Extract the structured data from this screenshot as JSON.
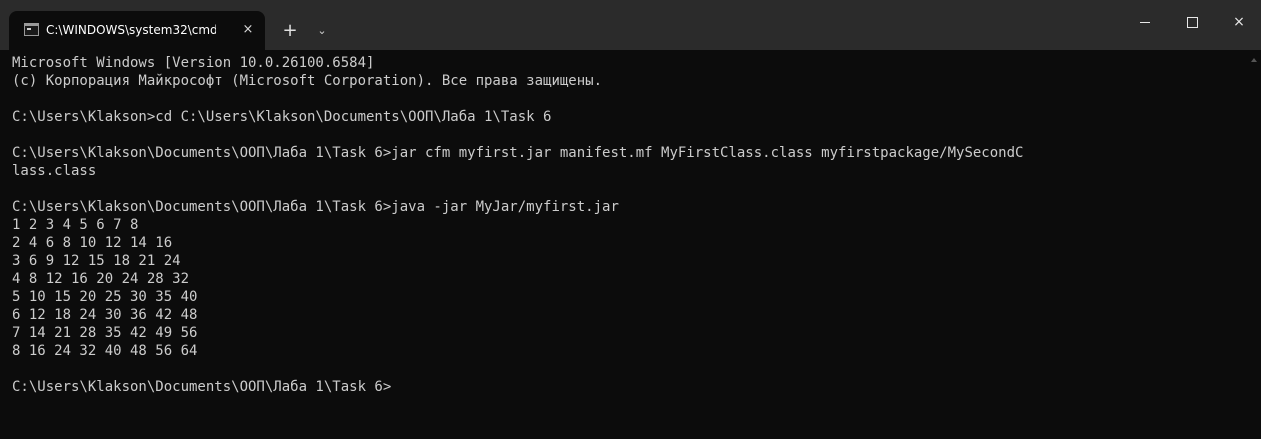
{
  "tab": {
    "title": "C:\\WINDOWS\\system32\\cmd.",
    "close_label": "×"
  },
  "titlebar": {
    "new_tab_label": "+",
    "dropdown_label": "⌄",
    "minimize_label": "—",
    "maximize_label": "□",
    "close_label": "×"
  },
  "console": {
    "lines": [
      "Microsoft Windows [Version 10.0.26100.6584]",
      "(c) Корпорация Майкрософт (Microsoft Corporation). Все права защищены.",
      "",
      "C:\\Users\\Klakson>cd C:\\Users\\Klakson\\Documents\\ООП\\Лаба 1\\Task 6",
      "",
      "C:\\Users\\Klakson\\Documents\\ООП\\Лаба 1\\Task 6>jar cfm myfirst.jar manifest.mf MyFirstClass.class myfirstpackage/MySecondC",
      "lass.class",
      "",
      "C:\\Users\\Klakson\\Documents\\ООП\\Лаба 1\\Task 6>java -jar MyJar/myfirst.jar",
      "1 2 3 4 5 6 7 8",
      "2 4 6 8 10 12 14 16",
      "3 6 9 12 15 18 21 24",
      "4 8 12 16 20 24 28 32",
      "5 10 15 20 25 30 35 40",
      "6 12 18 24 30 36 42 48",
      "7 14 21 28 35 42 49 56",
      "8 16 24 32 40 48 56 64",
      "",
      "C:\\Users\\Klakson\\Documents\\ООП\\Лаба 1\\Task 6>"
    ]
  },
  "colors": {
    "background": "#0c0c0c",
    "titlebar": "#2b2b2b",
    "text": "#cccccc"
  },
  "icons": {
    "tab": "terminal-icon",
    "new_tab": "plus-icon",
    "dropdown": "chevron-down-icon",
    "minimize": "minimize-icon",
    "maximize": "maximize-icon",
    "close": "close-icon"
  }
}
